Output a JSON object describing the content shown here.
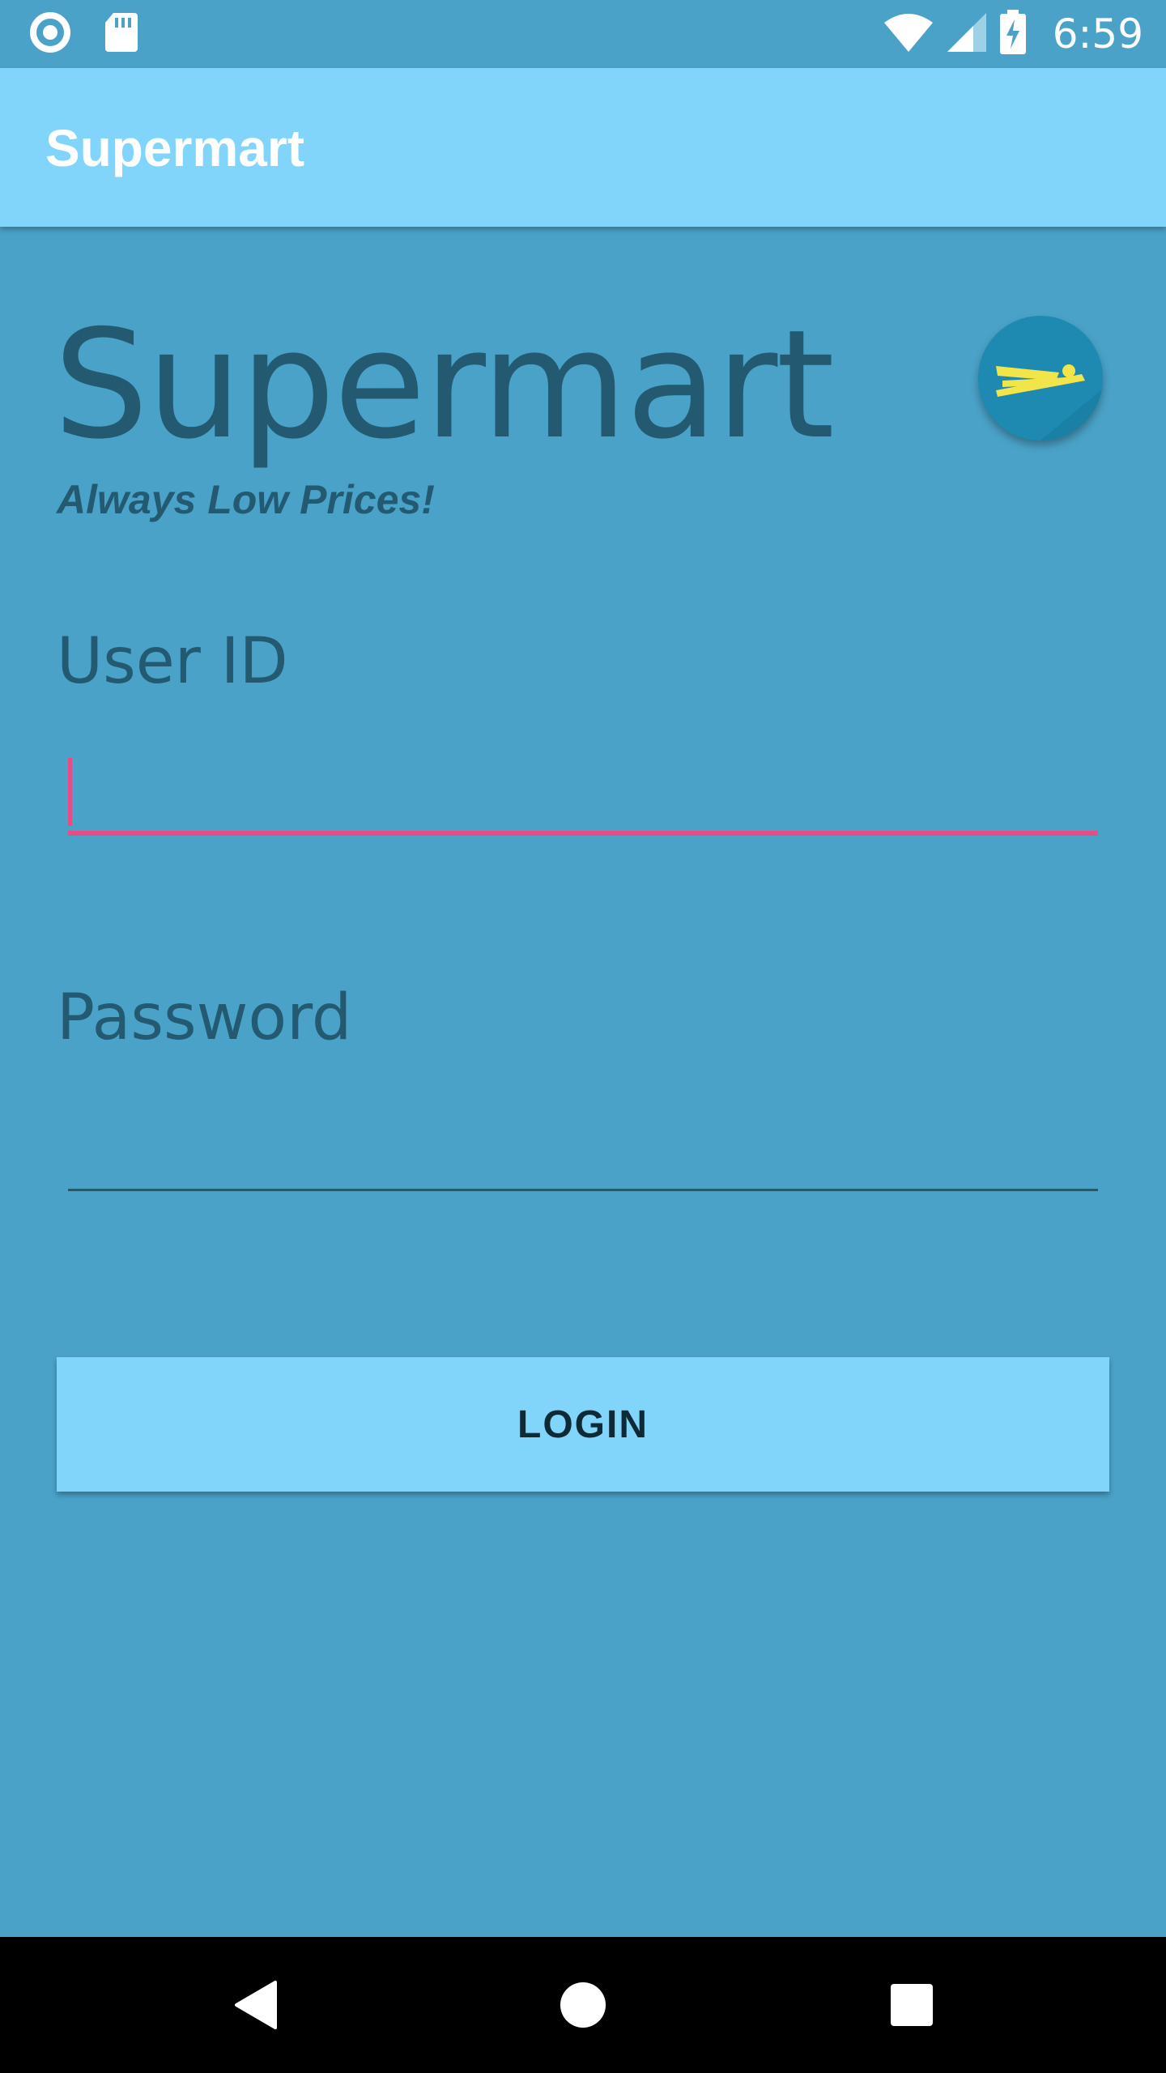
{
  "status_bar": {
    "time": "6:59",
    "icons": [
      "record-icon",
      "sd-card-icon",
      "wifi-icon",
      "cell-signal-icon",
      "battery-charging-icon"
    ]
  },
  "app_bar": {
    "title": "Supermart"
  },
  "brand": {
    "title": "Supermart",
    "tagline": "Always Low Prices!",
    "fab_icon": "swimmer-icon"
  },
  "form": {
    "user_id": {
      "label": "User ID",
      "value": ""
    },
    "password": {
      "label": "Password",
      "value": ""
    },
    "login_label": "LOGIN"
  },
  "nav_bar": {
    "icons": [
      "back-icon",
      "home-icon",
      "recents-icon"
    ]
  },
  "colors": {
    "background": "#4aa2c8",
    "app_bar": "#81d4fa",
    "text_dark": "#235a72",
    "accent": "#e94c85",
    "fab": "#1e8ab2",
    "fab_icon": "#f2e54a"
  }
}
